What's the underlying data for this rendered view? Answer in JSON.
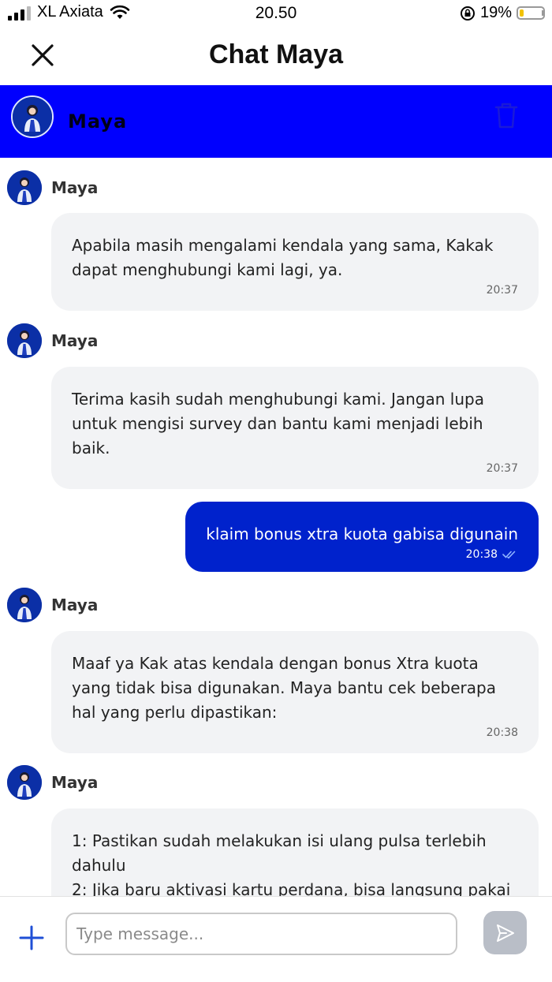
{
  "status_bar": {
    "carrier": "XL Axiata",
    "time": "20.50",
    "battery": "19%",
    "battery_level": 0.19
  },
  "header": {
    "title": "Chat Maya"
  },
  "agent": {
    "name": "Maya"
  },
  "messages": [
    {
      "sender": "Maya",
      "text": "Apabila masih mengalami kendala yang sama, Kakak dapat menghubungi kami lagi, ya.",
      "time": "20:37"
    },
    {
      "sender": "Maya",
      "text": "Terima kasih sudah menghubungi kami. Jangan lupa untuk mengisi survey dan bantu kami menjadi lebih baik.",
      "time": "20:37"
    },
    {
      "sender": "user",
      "text": "klaim bonus xtra kuota gabisa digunain",
      "time": "20:38"
    },
    {
      "sender": "Maya",
      "text": "Maaf ya Kak atas kendala dengan bonus Xtra kuota yang tidak bisa digunakan. Maya bantu cek beberapa hal yang perlu dipastikan:",
      "time": "20:38"
    },
    {
      "sender": "Maya",
      "text": "1: Pastikan sudah melakukan isi ulang pulsa terlebih dahulu\n2: Jika baru aktivasi kartu perdana, bisa langsung pakai",
      "time": ""
    }
  ],
  "composer": {
    "placeholder": "Type message..."
  },
  "colors": {
    "banner": "#0000fe",
    "outgoing_bubble": "#0022cc",
    "incoming_bubble": "#f2f3f5",
    "send_button": "#b9bec7"
  }
}
